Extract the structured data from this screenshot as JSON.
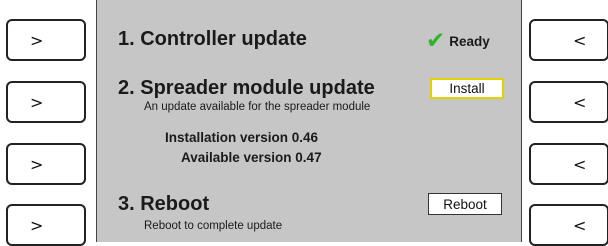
{
  "left_buttons": [
    ">",
    ">",
    ">",
    ">"
  ],
  "right_buttons": [
    "<",
    "<",
    "<",
    "<"
  ],
  "step1": {
    "title": "1. Controller update",
    "status_icon": "check-icon",
    "status_color": "#2fb52a",
    "status_text": "Ready"
  },
  "step2": {
    "title": "2. Spreader module update",
    "subtitle": "An update available for the spreader module",
    "button_label": "Install",
    "button_highlight_color": "#e3d000",
    "installation_version": "Installation version 0.46",
    "available_version": "Available version 0.47"
  },
  "step3": {
    "title": "3. Reboot",
    "subtitle": "Reboot to complete update",
    "button_label": "Reboot"
  }
}
